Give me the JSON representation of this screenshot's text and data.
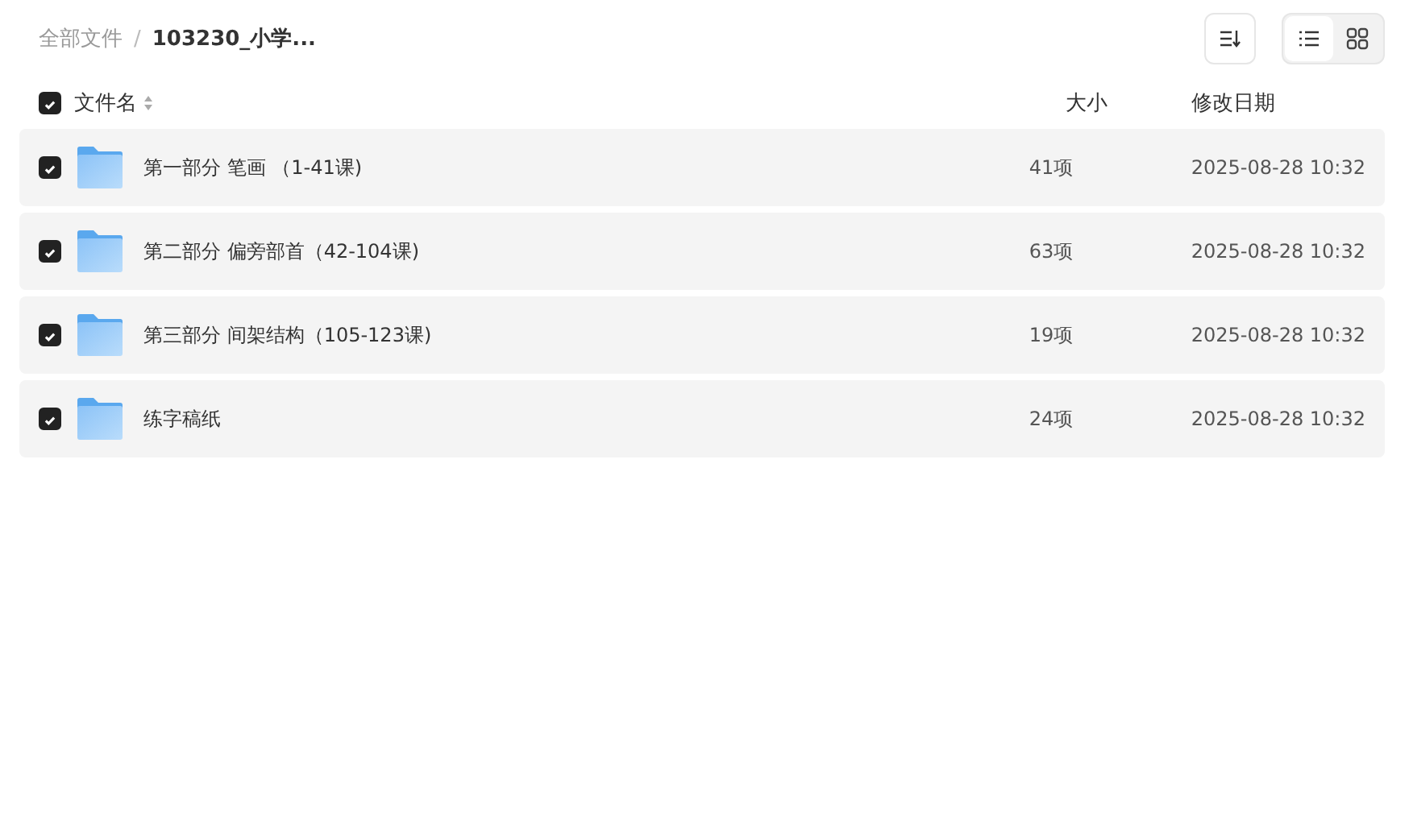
{
  "breadcrumb": [
    {
      "label": "全部文件",
      "current": false
    },
    {
      "label": "103230_小学...",
      "current": true
    }
  ],
  "breadcrumb_separator": "/",
  "view_modes": [
    {
      "kind": "list",
      "selected": true
    },
    {
      "kind": "grid",
      "selected": false
    }
  ],
  "table": {
    "select_all": {
      "checked": true
    },
    "columns": [
      "文件名",
      "大小",
      "修改日期"
    ],
    "rows": [
      {
        "checked": true,
        "name": "第一部分 笔画 （1-41课)",
        "size": "41项",
        "modified": "2025-08-28 10:32"
      },
      {
        "checked": true,
        "name": "第二部分 偏旁部首（42-104课)",
        "size": "63项",
        "modified": "2025-08-28 10:32"
      },
      {
        "checked": true,
        "name": "第三部分 间架结构（105-123课)",
        "size": "19项",
        "modified": "2025-08-28 10:32"
      },
      {
        "checked": true,
        "name": "练字稿纸",
        "size": "24项",
        "modified": "2025-08-28 10:32"
      }
    ]
  }
}
